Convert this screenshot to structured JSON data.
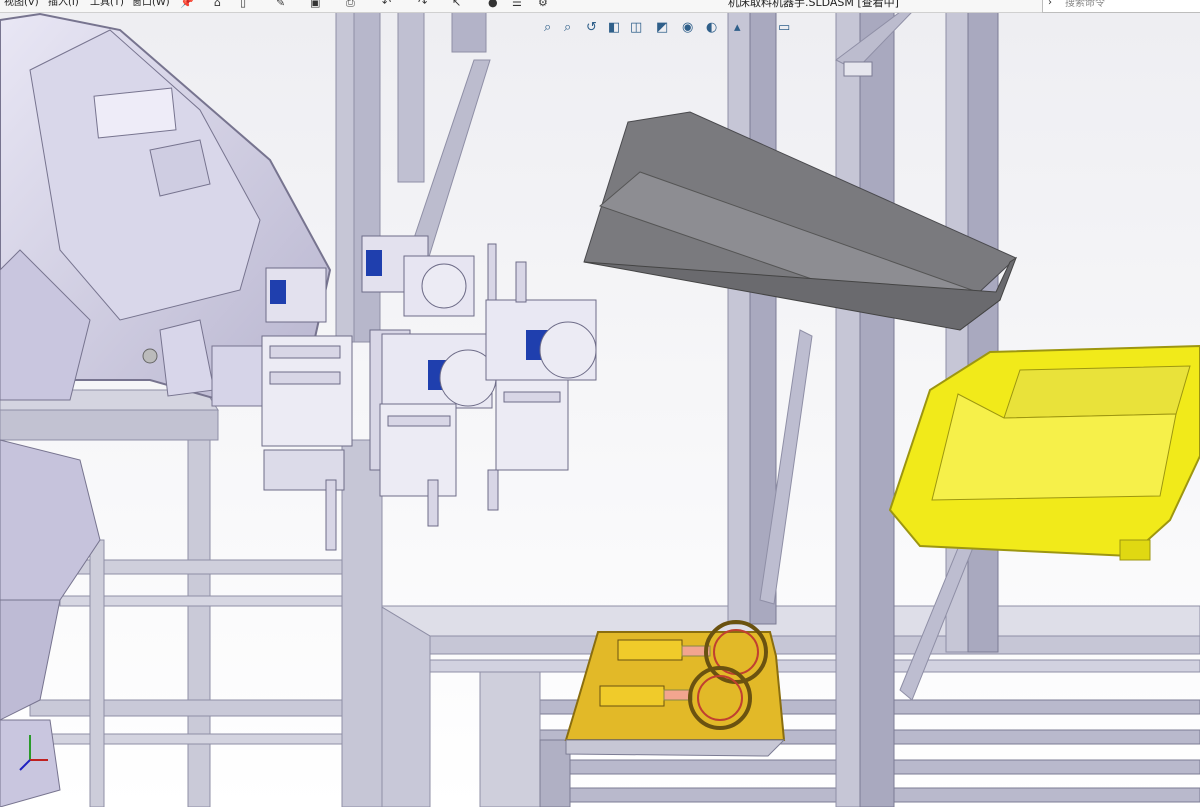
{
  "menu": {
    "items": [
      "视图(V)",
      "插入(I)",
      "工具(T)",
      "窗口(W)"
    ]
  },
  "document": {
    "title": "机床取料机器手.SLDASM [查看中]"
  },
  "search": {
    "placeholder": "搜索命令"
  },
  "toolbar": {
    "icons": [
      "pin-icon",
      "home-icon",
      "new-doc-icon",
      "open-icon",
      "save-icon",
      "print-icon",
      "undo-icon",
      "redo-icon",
      "select-icon",
      "rebuild-icon",
      "options-list-icon",
      "settings-icon"
    ]
  },
  "heads_up_view": {
    "icons": [
      "zoom-to-fit-icon",
      "zoom-area-icon",
      "previous-view-icon",
      "section-view-icon",
      "view-orientation-icon",
      "display-style-icon",
      "hide-show-icon",
      "appearance-icon",
      "scene-icon",
      "display-settings-icon"
    ]
  },
  "colors": {
    "frame": "#c6c6d6",
    "frame_dark": "#8f8fa6",
    "robot": "#d8d6ea",
    "hopper": "#77777a",
    "bin": "#f1ea1a",
    "fixture": "#e2b928",
    "sensor": "#1f3fae"
  }
}
